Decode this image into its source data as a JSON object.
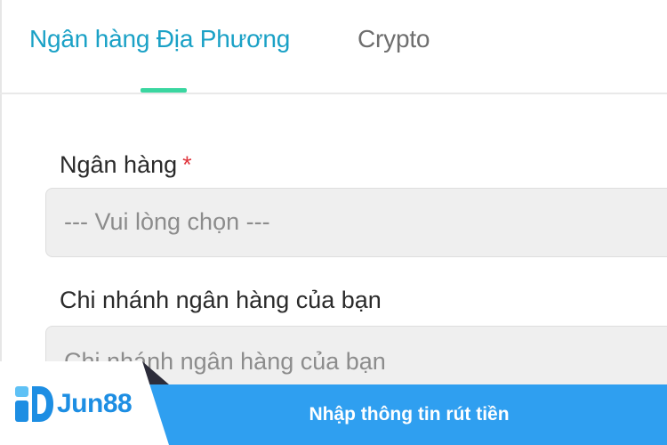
{
  "tabs": [
    {
      "label": "Ngân hàng Địa Phương",
      "active": true
    },
    {
      "label": "Crypto",
      "active": false
    }
  ],
  "form": {
    "bank": {
      "label": "Ngân hàng",
      "required_mark": "*",
      "placeholder": "--- Vui lòng chọn ---"
    },
    "branch": {
      "label": "Chi nhánh ngân hàng của bạn",
      "placeholder": "Chi nhánh ngân hàng của bạn"
    }
  },
  "banner": {
    "logo_text": "Jun88",
    "caption": "Nhập thông tin rút tiền"
  },
  "colors": {
    "accent": "#1aa1c6",
    "indicator": "#3ad6a0",
    "required": "#e0353d",
    "banner": "#2f9ff0"
  }
}
